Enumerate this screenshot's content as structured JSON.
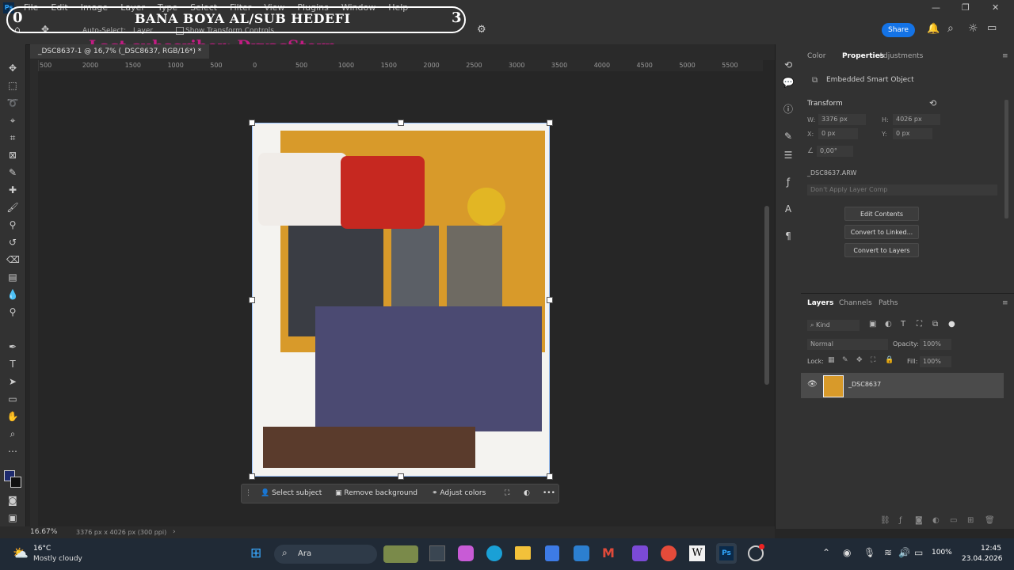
{
  "window": {
    "minimize": "—",
    "maximize": "❐",
    "close": "✕"
  },
  "menubar": {
    "items": [
      "File",
      "Edit",
      "Image",
      "Layer",
      "Type",
      "Select",
      "Filter",
      "View",
      "Plugins",
      "Window",
      "Help"
    ]
  },
  "overlay": {
    "left_number": "0",
    "title": "BANA BOYA AL/SUB HEDEFI",
    "right_number": "3",
    "subtitle": "Last subscriber: DryasStern"
  },
  "options": {
    "auto_select": "Auto-Select:",
    "layer": "Layer",
    "show_transform": "Show Transform Controls",
    "share": "Share"
  },
  "document": {
    "tab_title": "_DSC8637-1 @ 16,7% (_DSC8637, RGB/16*) *"
  },
  "ruler": {
    "ticks": [
      "500",
      "2000",
      "1500",
      "1000",
      "500",
      "0",
      "500",
      "1000",
      "1500",
      "2000",
      "2500",
      "3000",
      "3500",
      "4000",
      "4500",
      "5000",
      "5500"
    ]
  },
  "context_bar": {
    "select_subject": "Select subject",
    "remove_background": "Remove background",
    "adjust_colors": "Adjust colors",
    "more": "•••"
  },
  "status": {
    "zoom": "16.67%",
    "dims": "3376 px x 4026 px (300 ppi)",
    "arrow": "›"
  },
  "properties": {
    "tabs": [
      "Color",
      "Properties",
      "Adjustments"
    ],
    "object_type": "Embedded Smart Object",
    "transform_title": "Transform",
    "w_label": "W:",
    "w_value": "3376 px",
    "h_label": "H:",
    "h_value": "4026 px",
    "x_label": "X:",
    "x_value": "0 px",
    "y_label": "Y:",
    "y_value": "0 px",
    "angle_value": "0,00°",
    "filename": "_DSC8637.ARW",
    "layer_comp": "Don't Apply Layer Comp",
    "buttons": [
      "Edit Contents",
      "Convert to Linked...",
      "Convert to Layers"
    ]
  },
  "layers": {
    "tabs": [
      "Layers",
      "Channels",
      "Paths"
    ],
    "filter_kind": "Kind",
    "blend_mode": "Normal",
    "opacity_label": "Opacity:",
    "opacity_value": "100%",
    "lock_label": "Lock:",
    "fill_label": "Fill:",
    "fill_value": "100%",
    "layer_name": "_DSC8637"
  },
  "taskbar": {
    "temperature": "16°C",
    "weather": "Mostly cloudy",
    "search": "Ara",
    "time": "12:45",
    "date": "23.04.2026",
    "battery": "100%"
  },
  "colors": {
    "accent": "#1473e6",
    "overlay_magenta": "#d21a8c"
  }
}
